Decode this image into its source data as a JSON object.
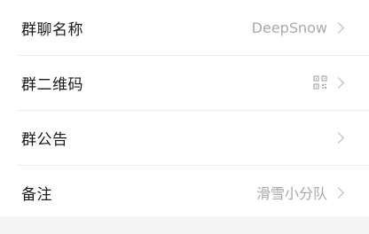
{
  "group_settings": {
    "name": {
      "label": "群聊名称",
      "value": "DeepSnow"
    },
    "qr_code": {
      "label": "群二维码",
      "icon": "qr-code-icon"
    },
    "announcement": {
      "label": "群公告"
    },
    "remark": {
      "label": "备注",
      "value": "滑雪小分队"
    }
  },
  "icons": {
    "chevron": "chevron-right-icon",
    "qr": "qr-code-icon"
  }
}
